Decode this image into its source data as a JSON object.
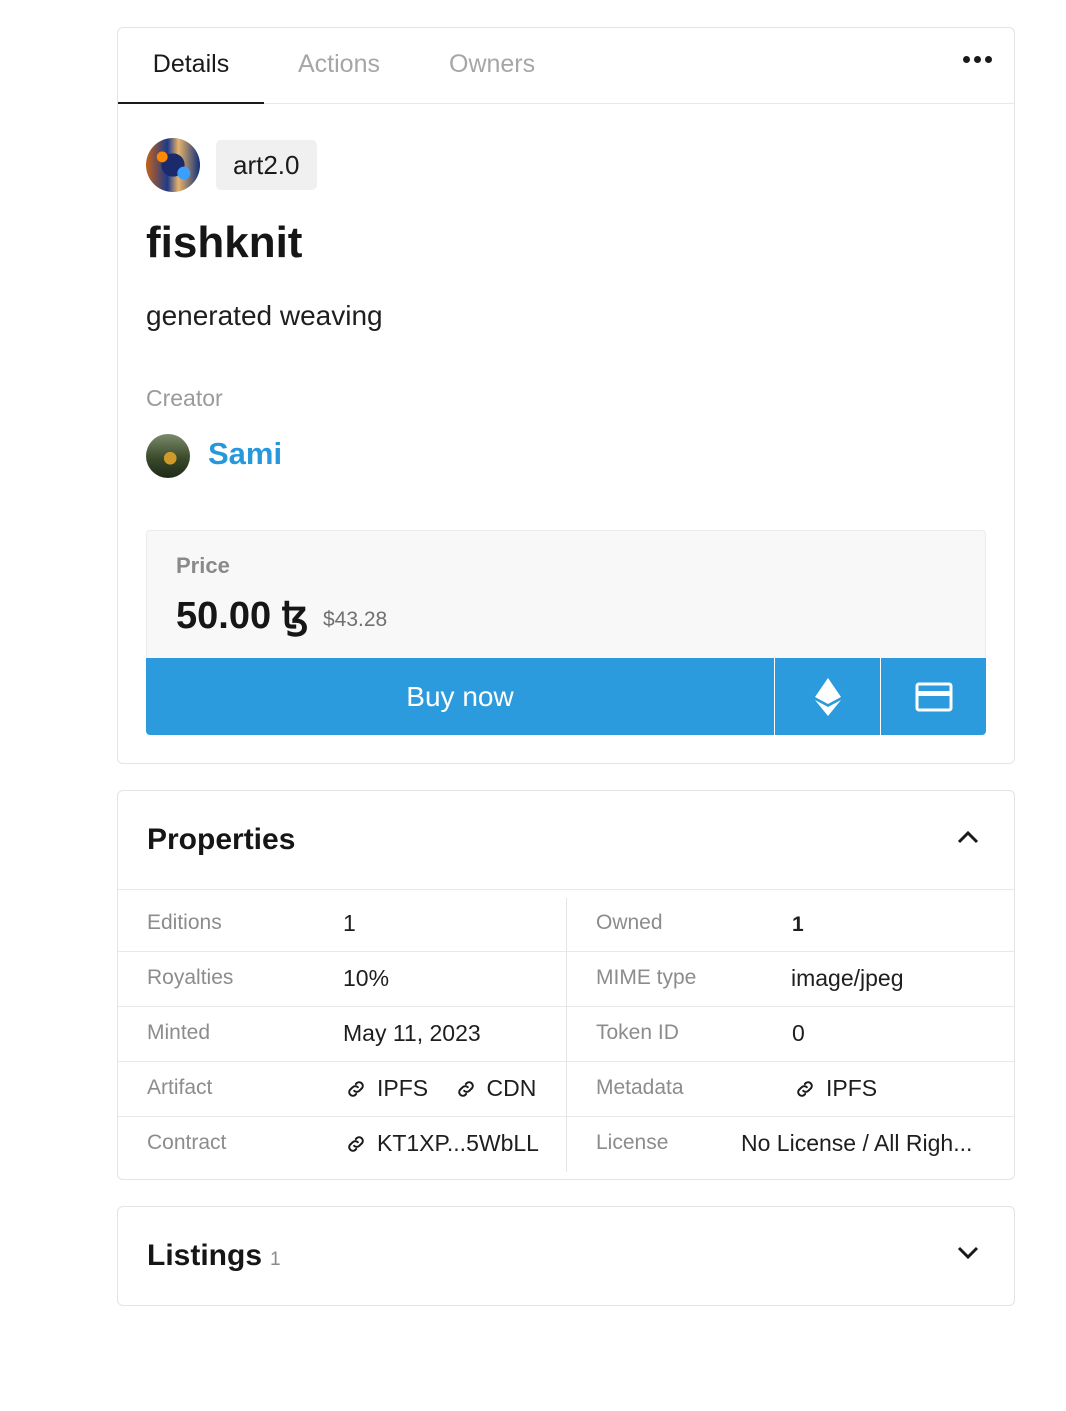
{
  "tabs": [
    {
      "label": "Details"
    },
    {
      "label": "Actions"
    },
    {
      "label": "Owners"
    }
  ],
  "collection": {
    "tag": "art2.0"
  },
  "token": {
    "title": "fishknit",
    "description": "generated weaving"
  },
  "creator": {
    "label": "Creator",
    "name": "Sami"
  },
  "price": {
    "label": "Price",
    "amount": "50.00 ꜩ",
    "usd": "$43.28"
  },
  "buy": {
    "label": "Buy now",
    "eth_icon": "ethereum-icon",
    "card_icon": "credit-card-icon"
  },
  "properties": {
    "title": "Properties",
    "rows": [
      {
        "k1": "Editions",
        "v1": "1",
        "k2": "Owned",
        "v2": "1"
      },
      {
        "k1": "Royalties",
        "v1": "10%",
        "k2": "MIME type",
        "v2": "image/jpeg"
      },
      {
        "k1": "Minted",
        "v1": "May 11, 2023",
        "k2": "Token ID",
        "v2": "0"
      },
      {
        "k1": "Artifact",
        "v1a": "IPFS",
        "v1b": "CDN",
        "k2": "Metadata",
        "v2": "IPFS"
      },
      {
        "k1": "Contract",
        "v1": "KT1XP...5WbLL",
        "k2": "License",
        "v2": "No License / All Righ..."
      }
    ]
  },
  "listings": {
    "title": "Listings",
    "count": "1"
  },
  "colors": {
    "accent": "#2b9bdd",
    "link": "#2799db"
  }
}
